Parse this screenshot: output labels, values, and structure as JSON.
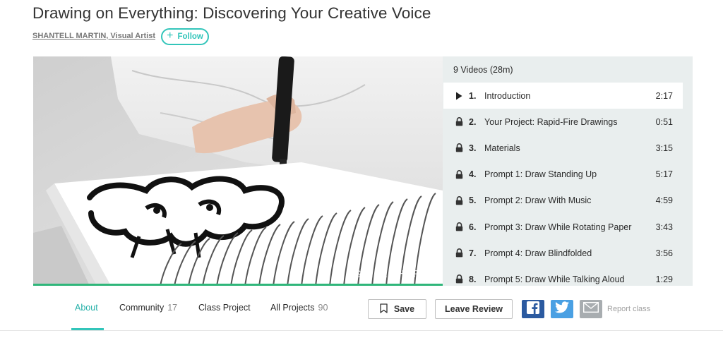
{
  "course": {
    "title": "Drawing on Everything: Discovering Your Creative Voice",
    "author": "SHANTELL MARTIN, Visual Artist",
    "follow_label": "Follow"
  },
  "player": {
    "watermark": "SKILLSHARE",
    "progress": 1.0
  },
  "playlist": {
    "header": "9 Videos (28m)",
    "items": [
      {
        "num": "1.",
        "title": "Introduction",
        "duration": "2:17",
        "icon": "play-icon"
      },
      {
        "num": "2.",
        "title": "Your Project: Rapid-Fire Drawings",
        "duration": "0:51",
        "icon": "lock-icon"
      },
      {
        "num": "3.",
        "title": "Materials",
        "duration": "3:15",
        "icon": "lock-icon"
      },
      {
        "num": "4.",
        "title": "Prompt 1: Draw Standing Up",
        "duration": "5:17",
        "icon": "lock-icon"
      },
      {
        "num": "5.",
        "title": "Prompt 2: Draw With Music",
        "duration": "4:59",
        "icon": "lock-icon"
      },
      {
        "num": "6.",
        "title": "Prompt 3: Draw While Rotating Paper",
        "duration": "3:43",
        "icon": "lock-icon"
      },
      {
        "num": "7.",
        "title": "Prompt 4: Draw Blindfolded",
        "duration": "3:56",
        "icon": "lock-icon"
      },
      {
        "num": "8.",
        "title": "Prompt 5: Draw While Talking Aloud",
        "duration": "1:29",
        "icon": "lock-icon"
      }
    ]
  },
  "tabs": {
    "about": "About",
    "community": "Community",
    "community_count": "17",
    "class_project": "Class Project",
    "all_projects": "All Projects",
    "all_projects_count": "90"
  },
  "actions": {
    "save_label": "Save",
    "review_label": "Leave Review",
    "report_label": "Report class"
  },
  "colors": {
    "accent": "#32c5ba",
    "facebook": "#2b5aa0",
    "twitter": "#4aa0e3",
    "mail": "#a8adb0"
  }
}
